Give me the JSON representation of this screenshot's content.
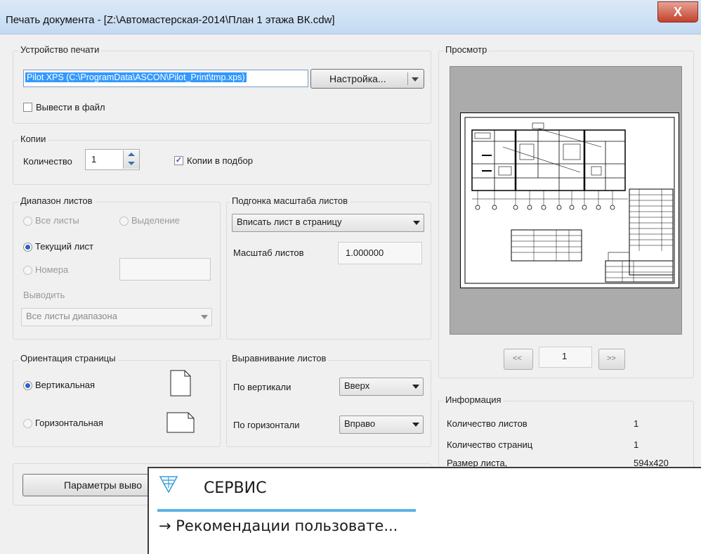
{
  "window": {
    "title": "Печать документа - [Z:\\Автомастерская-2014\\План 1 этажа ВК.cdw]",
    "close_label": "X"
  },
  "device": {
    "group_label": "Устройство печати",
    "printer_value": "Pilot XPS (C:\\ProgramData\\ASCON\\Pilot_Print\\tmp.xps)",
    "setup_button": "Настройка...",
    "print_to_file_label": "Вывести в файл"
  },
  "copies": {
    "group_label": "Копии",
    "count_label": "Количество",
    "count_value": "1",
    "collate_label": "Копии в подбор"
  },
  "range": {
    "group_label": "Диапазон листов",
    "all_label": "Все листы",
    "selection_label": "Выделение",
    "current_label": "Текущий лист",
    "numbers_label": "Номера",
    "output_label": "Выводить",
    "output_value": "Все листы диапазона"
  },
  "scale": {
    "group_label": "Подгонка масштаба листов",
    "fit_value": "Вписать лист в страницу",
    "scale_label": "Масштаб листов",
    "scale_value": "1.000000"
  },
  "orientation": {
    "group_label": "Ориентация страницы",
    "portrait_label": "Вертикальная",
    "landscape_label": "Горизонтальная"
  },
  "align": {
    "group_label": "Выравнивание листов",
    "vertical_label": "По вертикали",
    "vertical_value": "Вверх",
    "horizontal_label": "По горизонтали",
    "horizontal_value": "Вправо"
  },
  "output_params_button": "Параметры выво",
  "preview": {
    "group_label": "Просмотр",
    "prev_label": "<<",
    "page_value": "1",
    "next_label": ">>"
  },
  "info": {
    "group_label": "Информация",
    "rows": [
      {
        "label": "Количество листов",
        "value": "1"
      },
      {
        "label": "Количество страниц",
        "value": "1"
      },
      {
        "label": "Размер листа,",
        "value": "594x420"
      }
    ]
  },
  "overlay": {
    "heading": "СЕРВИС",
    "link": "→ Рекомендации пользовате..."
  },
  "colors": {
    "accent": "#2a62c9",
    "selection": "#3399ff",
    "close": "#c2412c",
    "overlay_rule": "#5bb3e6"
  }
}
